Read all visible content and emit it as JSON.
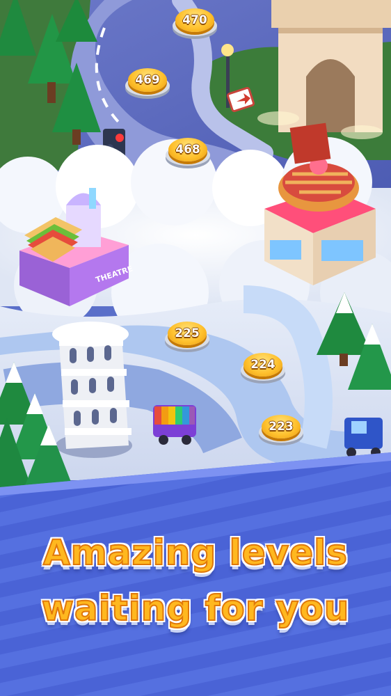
{
  "map": {
    "levels": [
      {
        "number": "470",
        "state": "locked"
      },
      {
        "number": "469",
        "state": "locked"
      },
      {
        "number": "468",
        "state": "locked"
      },
      {
        "number": "225",
        "state": "available"
      },
      {
        "number": "224",
        "state": "available"
      },
      {
        "number": "223",
        "state": "available"
      }
    ],
    "landmarks": {
      "theatre_sign": "THEATRE"
    }
  },
  "promo": {
    "line1": "Amazing levels",
    "line2": "waiting for you"
  },
  "colors": {
    "coin": "#ffc12e",
    "headline": "#ffb81f",
    "banner": "#4f65d6",
    "cloud": "#eef2fa",
    "road": "#6f7fcf"
  }
}
